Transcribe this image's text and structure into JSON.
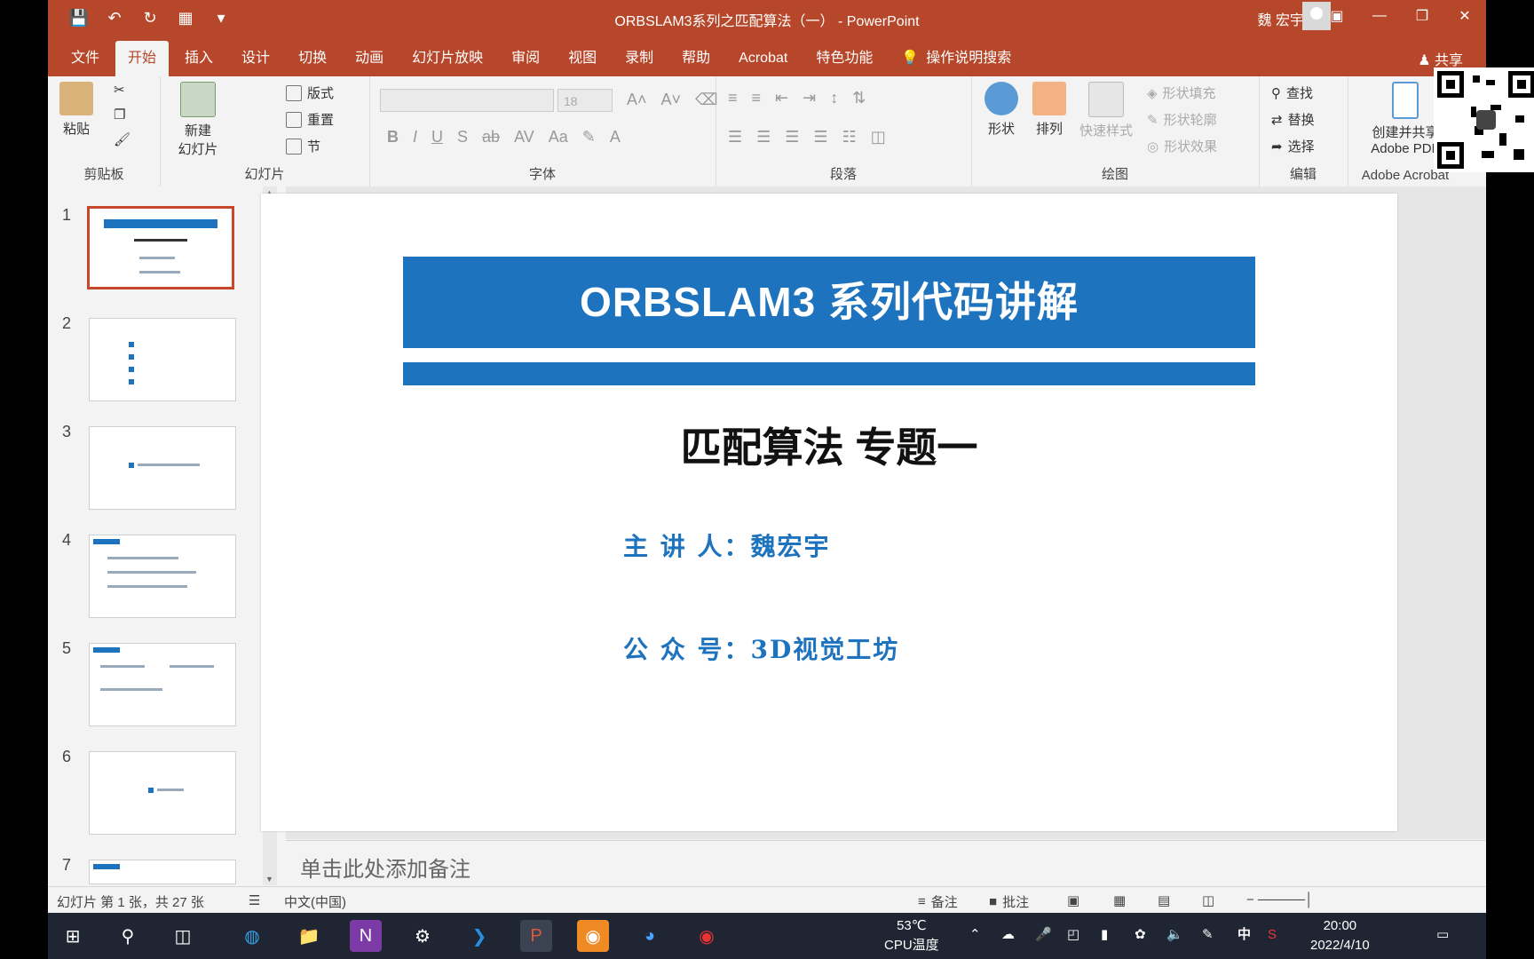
{
  "window": {
    "title": "ORBSLAM3系列之匹配算法（一） - PowerPoint",
    "user_name": "魏 宏宇",
    "accent_color": "#b7472a"
  },
  "menu": {
    "tabs": [
      "文件",
      "开始",
      "插入",
      "设计",
      "切换",
      "动画",
      "幻灯片放映",
      "审阅",
      "视图",
      "录制",
      "帮助",
      "Acrobat",
      "特色功能"
    ],
    "active_tab": "开始",
    "tell_me": "操作说明搜索",
    "share": "共享"
  },
  "ribbon": {
    "clipboard": {
      "paste": "粘贴",
      "label": "剪贴板"
    },
    "slides": {
      "new_slide_line1": "新建",
      "new_slide_line2": "幻灯片",
      "layout": "版式",
      "reset": "重置",
      "section": "节",
      "label": "幻灯片"
    },
    "font": {
      "font_size": "18",
      "label": "字体"
    },
    "paragraph": {
      "label": "段落"
    },
    "drawing": {
      "shape": "形状",
      "arrange": "排列",
      "quick_styles": "快速样式",
      "fill": "形状填充",
      "outline": "形状轮廓",
      "effects": "形状效果",
      "label": "绘图"
    },
    "editing": {
      "find": "查找",
      "replace": "替换",
      "select": "选择",
      "label": "编辑"
    },
    "acrobat": {
      "create_line1": "创建并共享",
      "create_line2": "Adobe PDF",
      "label": "Adobe Acrobat"
    }
  },
  "thumbnails": [
    "1",
    "2",
    "3",
    "4",
    "5",
    "6",
    "7"
  ],
  "slide": {
    "banner_title": "ORBSLAM3 系列代码讲解",
    "subtitle": "匹配算法 专题一",
    "presenter": "主 讲 人：魏宏宇",
    "account": "公 众 号：3D视觉工坊",
    "accent_color": "#1e73be"
  },
  "notes": {
    "placeholder": "单击此处添加备注"
  },
  "statusbar": {
    "slide_info": "幻灯片 第 1 张，共 27 张",
    "language": "中文(中国)",
    "notes": "备注",
    "comments": "批注"
  },
  "taskbar": {
    "temperature": "53℃",
    "cpu_label": "CPU温度",
    "ime": "中",
    "time": "20:00",
    "date": "2022/4/10"
  }
}
